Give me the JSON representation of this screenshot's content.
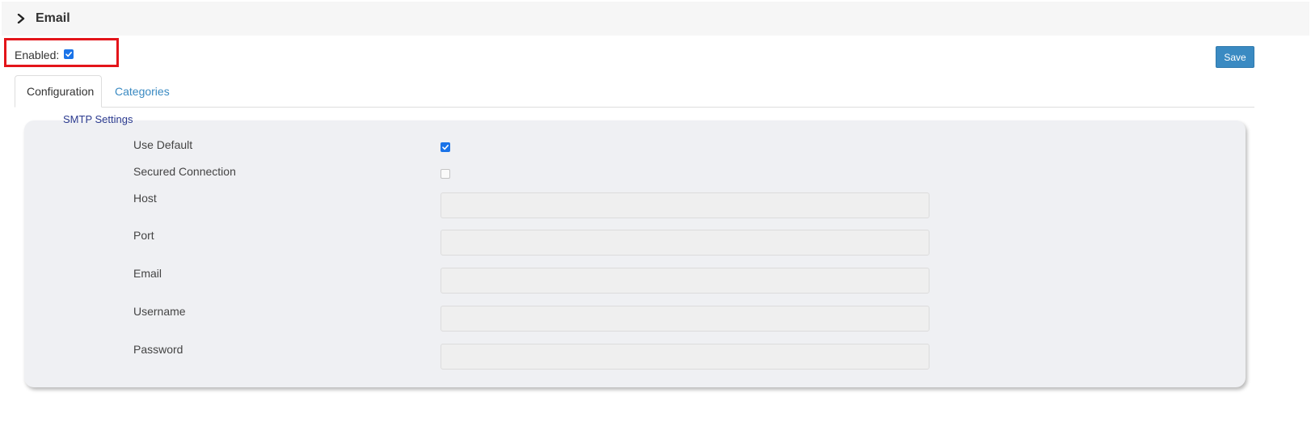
{
  "section": {
    "title": "Email",
    "expand_icon": "chevron-right-icon"
  },
  "enabled": {
    "label": "Enabled:",
    "checked": true
  },
  "toolbar": {
    "save_label": "Save"
  },
  "tabs": [
    {
      "label": "Configuration",
      "active": true
    },
    {
      "label": "Categories",
      "active": false
    }
  ],
  "smtp": {
    "legend": "SMTP Settings",
    "use_default": {
      "label": "Use Default",
      "checked": true
    },
    "secured_connection": {
      "label": "Secured Connection",
      "checked": false
    },
    "host": {
      "label": "Host",
      "value": ""
    },
    "port": {
      "label": "Port",
      "value": ""
    },
    "email": {
      "label": "Email",
      "value": ""
    },
    "username": {
      "label": "Username",
      "value": ""
    },
    "password": {
      "label": "Password",
      "value": ""
    }
  },
  "colors": {
    "accent": "#3a8ac2",
    "checkbox_checked": "#1a73e8",
    "highlight": "#e3141a",
    "legend_text": "#2b3a8f",
    "panel_bg": "#eff0f3"
  }
}
